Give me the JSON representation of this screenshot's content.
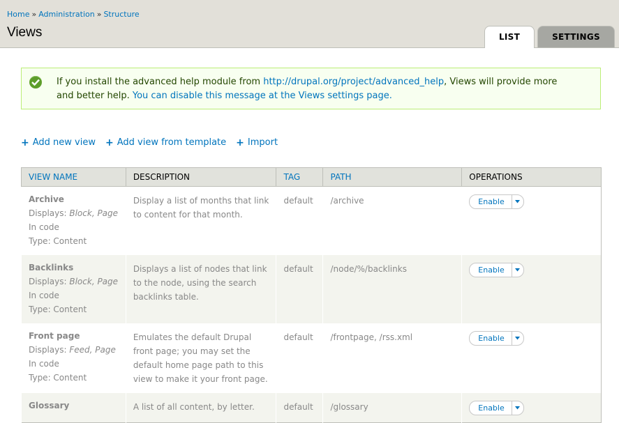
{
  "breadcrumb": {
    "home": "Home",
    "sep1": "»",
    "admin": "Administration",
    "sep2": "»",
    "structure": "Structure"
  },
  "page": {
    "title": "Views"
  },
  "tabs": [
    {
      "label": "LIST",
      "active": true
    },
    {
      "label": "SETTINGS",
      "active": false
    }
  ],
  "message": {
    "text_before": "If you install the advanced help module from ",
    "link": "http://drupal.org/project/advanced_help",
    "text_after": ", Views will provide more and better help. ",
    "disable_link": "You can disable this message at the Views settings page."
  },
  "actions": {
    "add_new": "Add new view",
    "add_template": "Add view from template",
    "import": "Import"
  },
  "table": {
    "headers": {
      "name": "VIEW NAME",
      "description": "DESCRIPTION",
      "tag": "TAG",
      "path": "PATH",
      "operations": "OPERATIONS"
    },
    "rows": [
      {
        "name": "Archive",
        "displays_label": "Displays:",
        "displays": "Block, Page",
        "storage": "In code",
        "type": "Type: Content",
        "description": "Display a list of months that link to content for that month.",
        "tag": "default",
        "path": "/archive",
        "operation": "Enable"
      },
      {
        "name": "Backlinks",
        "displays_label": "Displays:",
        "displays": "Block, Page",
        "storage": "In code",
        "type": "Type: Content",
        "description": "Displays a list of nodes that link to the node, using the search backlinks table.",
        "tag": "default",
        "path": "/node/%/backlinks",
        "operation": "Enable"
      },
      {
        "name": "Front page",
        "displays_label": "Displays:",
        "displays": "Feed, Page",
        "storage": "In code",
        "type": "Type: Content",
        "description": "Emulates the default Drupal front page; you may set the default home page path to this view to make it your front page.",
        "tag": "default",
        "path": "/frontpage, /rss.xml",
        "operation": "Enable"
      },
      {
        "name": "Glossary",
        "displays_label": "",
        "displays": "",
        "storage": "",
        "type": "",
        "description": "A list of all content, by letter.",
        "tag": "default",
        "path": "/glossary",
        "operation": "Enable"
      }
    ]
  },
  "colors": {
    "link": "#0074bd",
    "header_bg": "#e2e0d9",
    "message_bg": "#f8fff0",
    "check": "#5d9d2a"
  }
}
